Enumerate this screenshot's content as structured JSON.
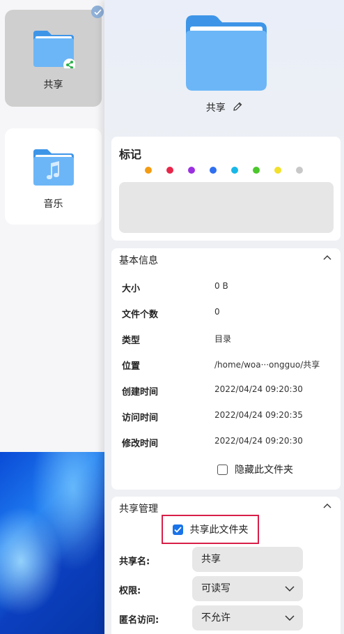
{
  "files": [
    {
      "name": "共享",
      "selected": true,
      "badge_icon": "share-icon"
    },
    {
      "name": "音乐",
      "selected": false,
      "badge_icon": "music-note-icon"
    }
  ],
  "details": {
    "folder_name": "共享",
    "tags": {
      "title": "标记",
      "colors": [
        "#f39c12",
        "#e8264a",
        "#9b30e0",
        "#2f6ff0",
        "#18b7e8",
        "#4cc72c",
        "#f2e02a",
        "#c8c8c8"
      ]
    },
    "basic_info": {
      "title": "基本信息",
      "rows": [
        {
          "label": "大小",
          "value": "0 B"
        },
        {
          "label": "文件个数",
          "value": "0"
        },
        {
          "label": "类型",
          "value": "目录"
        },
        {
          "label": "位置",
          "value": "/home/woa···ongguo/共享"
        },
        {
          "label": "创建时间",
          "value": "2022/04/24 09:20:30"
        },
        {
          "label": "访问时间",
          "value": "2022/04/24 09:20:35"
        },
        {
          "label": "修改时间",
          "value": "2022/04/24 09:20:30"
        }
      ],
      "hide_folder_label": "隐藏此文件夹"
    },
    "share": {
      "title": "共享管理",
      "share_folder_label": "共享此文件夹",
      "share_name_label": "共享名:",
      "share_name_value": "共享",
      "permission_label": "权限:",
      "permission_value": "可读写",
      "anonymous_label": "匿名访问:",
      "anonymous_value": "不允许"
    }
  }
}
